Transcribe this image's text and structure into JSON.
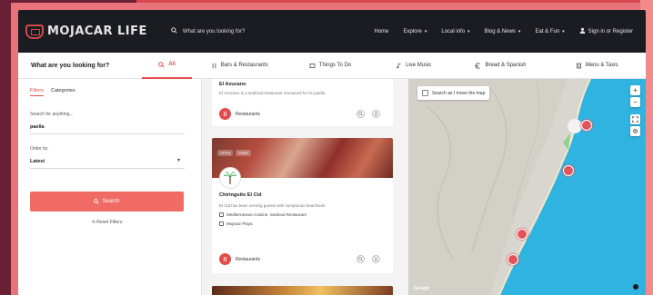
{
  "brand": {
    "logo_text": "MOJACAR LIFE",
    "accent": "#e24c4c",
    "navbar_bg": "#1b1b22"
  },
  "navbar": {
    "search_placeholder": "What are you looking for?",
    "links": [
      "Home",
      "Explore",
      "Local info",
      "Blog & News",
      "Eat & Fun"
    ],
    "signin": "Sign in or Register"
  },
  "tabs": {
    "title": "What are you looking for?",
    "items": [
      "All",
      "Bars & Restaurants",
      "Things To Do",
      "Live Music",
      "Bread & Spanish",
      "Menu & Taxis"
    ]
  },
  "filters": {
    "tab_filters": "Filters",
    "tab_categories": "Categories",
    "search_label": "Search for anything...",
    "search_value": "paella",
    "order_label": "Order by",
    "order_value": "Latest",
    "search_button": "Search",
    "reset": "Reset Filters"
  },
  "listings": [
    {
      "title": "El Azucano",
      "desc": "El Azucano is a seafood restaurant renowned for its paella",
      "category": "Restaurants"
    },
    {
      "title": "Chiringuito El Cid",
      "desc": "El Cid has been serving guests with sumptuous beachside",
      "tags": [
        "OPEN",
        "FREE"
      ],
      "features": [
        "Mediterranean Cuisine, Seafood Restaurant",
        "Mojacar Playa"
      ],
      "category": "Restaurants"
    }
  ],
  "map": {
    "search_as_move": "Search as I move the map",
    "zoom_in": "+",
    "zoom_out": "−",
    "provider": "Google"
  }
}
